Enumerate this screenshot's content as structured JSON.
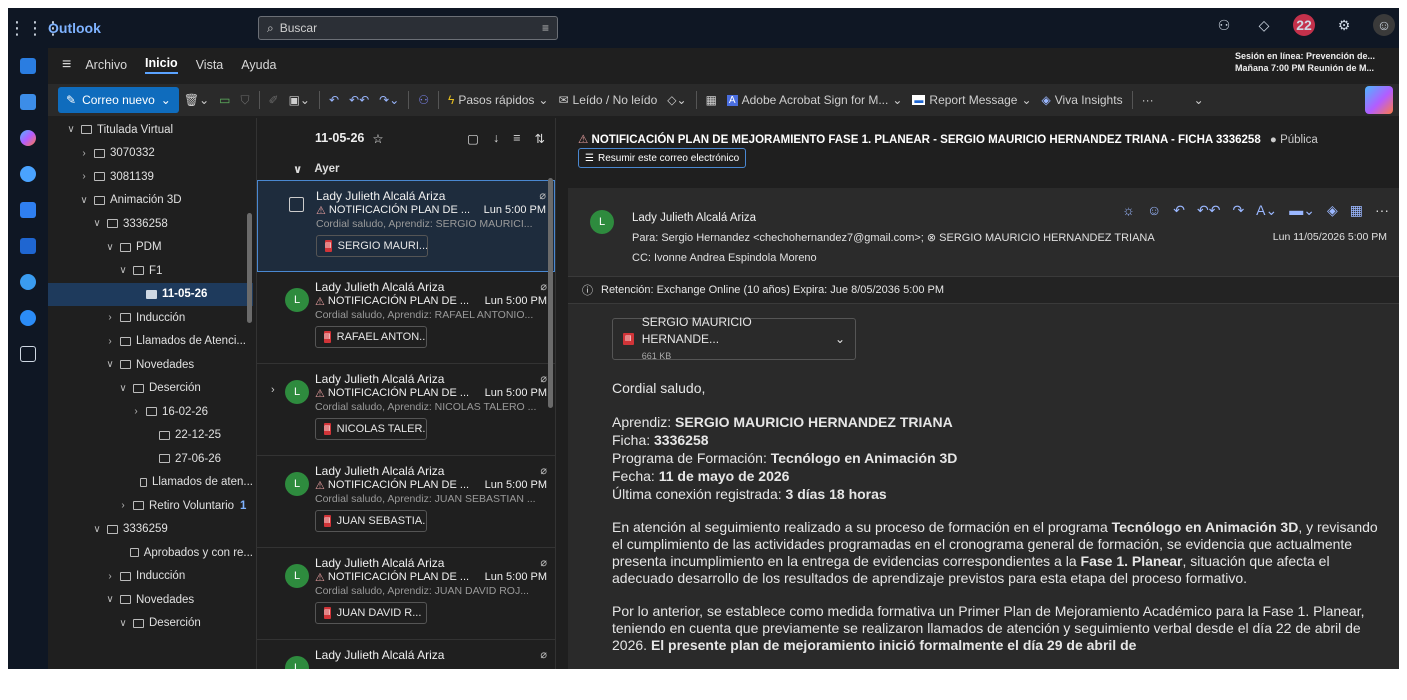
{
  "app": {
    "name": "Outlook"
  },
  "search": {
    "placeholder": "Buscar"
  },
  "topbar": {
    "notif_count": "22"
  },
  "menu": {
    "items": [
      "Archivo",
      "Inicio",
      "Vista",
      "Ayuda"
    ],
    "active": "Inicio"
  },
  "notification": {
    "line1": "Sesión en línea: Prevención de...",
    "line2": "Mañana 7:00 PM Reunión de M..."
  },
  "toolbar": {
    "new_mail": "Correo nuevo",
    "quick_steps": "Pasos rápidos",
    "read_unread": "Leído / No leído",
    "adobe": "Adobe Acrobat Sign for M...",
    "report": "Report Message",
    "viva": "Viva Insights",
    "more": "···"
  },
  "folders": [
    {
      "label": "Titulada Virtual",
      "indent": 0,
      "chev": "∨"
    },
    {
      "label": "3070332",
      "indent": 1,
      "chev": "›"
    },
    {
      "label": "3081139",
      "indent": 1,
      "chev": "›"
    },
    {
      "label": "Animación 3D",
      "indent": 1,
      "chev": "∨"
    },
    {
      "label": "3336258",
      "indent": 2,
      "chev": "∨"
    },
    {
      "label": "PDM",
      "indent": 3,
      "chev": "∨"
    },
    {
      "label": "F1",
      "indent": 4,
      "chev": "∨"
    },
    {
      "label": "11-05-26",
      "indent": 5,
      "chev": "",
      "selected": true
    },
    {
      "label": "Inducción",
      "indent": 3,
      "chev": "›"
    },
    {
      "label": "Llamados de Atenci...",
      "indent": 3,
      "chev": "›"
    },
    {
      "label": "Novedades",
      "indent": 3,
      "chev": "∨"
    },
    {
      "label": "Deserción",
      "indent": 4,
      "chev": "∨"
    },
    {
      "label": "16-02-26",
      "indent": 5,
      "chev": "›"
    },
    {
      "label": "22-12-25",
      "indent": 6,
      "chev": ""
    },
    {
      "label": "27-06-26",
      "indent": 6,
      "chev": ""
    },
    {
      "label": "Llamados de aten...",
      "indent": 5,
      "chev": ""
    },
    {
      "label": "Retiro Voluntario",
      "indent": 4,
      "chev": "›",
      "count": "1"
    },
    {
      "label": "3336259",
      "indent": 2,
      "chev": "∨"
    },
    {
      "label": "Aprobados y con re...",
      "indent": 4,
      "chev": ""
    },
    {
      "label": "Inducción",
      "indent": 3,
      "chev": "›"
    },
    {
      "label": "Novedades",
      "indent": 3,
      "chev": "∨"
    },
    {
      "label": "Deserción",
      "indent": 4,
      "chev": "∨"
    }
  ],
  "list": {
    "folder_title": "11-05-26",
    "group": "Ayer",
    "messages": [
      {
        "sender": "Lady Julieth Alcalá Ariza",
        "subject": "NOTIFICACIÓN PLAN DE ...",
        "time": "Lun 5:00 PM",
        "preview": "Cordial saludo, Aprendiz: SERGIO MAURICI...",
        "attachment": "SERGIO MAURI...",
        "selected": true
      },
      {
        "sender": "Lady Julieth Alcalá Ariza",
        "subject": "NOTIFICACIÓN PLAN DE ...",
        "time": "Lun 5:00 PM",
        "preview": "Cordial saludo, Aprendiz: RAFAEL ANTONIO...",
        "attachment": "RAFAEL ANTON..."
      },
      {
        "sender": "Lady Julieth Alcalá Ariza",
        "subject": "NOTIFICACIÓN PLAN DE ...",
        "time": "Lun 5:00 PM",
        "preview": "Cordial saludo, Aprendiz: NICOLAS TALERO ...",
        "attachment": "NICOLAS TALER...",
        "expand": true
      },
      {
        "sender": "Lady Julieth Alcalá Ariza",
        "subject": "NOTIFICACIÓN PLAN DE ...",
        "time": "Lun 5:00 PM",
        "preview": "Cordial saludo, Aprendiz: JUAN SEBASTIAN ...",
        "attachment": "JUAN SEBASTIA..."
      },
      {
        "sender": "Lady Julieth Alcalá Ariza",
        "subject": "NOTIFICACIÓN PLAN DE ...",
        "time": "Lun 5:00 PM",
        "preview": "Cordial saludo, Aprendiz: JUAN DAVID ROJ...",
        "attachment": "JUAN DAVID R..."
      },
      {
        "sender": "Lady Julieth Alcalá Ariza",
        "subject": "",
        "time": "",
        "preview": "",
        "attachment": ""
      }
    ]
  },
  "reading": {
    "subject": "NOTIFICACIÓN PLAN DE MEJORAMIENTO FASE 1. PLANEAR  - SERGIO MAURICIO HERNANDEZ TRIANA - FICHA 3336258",
    "visibility": "Pública",
    "summarize": "Resumir este correo electrónico",
    "from": "Lady Julieth Alcalá Ariza",
    "avatar": "L",
    "to": "Para:  Sergio Hernandez <chechohernandez7@gmail.com>;  ⊗ SERGIO MAURICIO HERNANDEZ TRIANA",
    "cc": "CC:  Ivonne Andrea Espindola Moreno",
    "date": "Lun 11/05/2026 5:00 PM",
    "retention": "Retención: Exchange Online (10 años) Expira: Jue 8/05/2036 5:00 PM",
    "attachment_name": "SERGIO MAURICIO HERNANDE...",
    "attachment_size": "661 KB",
    "greeting": "Cordial saludo,",
    "aprendiz_label": "Aprendiz: ",
    "aprendiz": "SERGIO MAURICIO HERNANDEZ TRIANA",
    "ficha_label": "Ficha: ",
    "ficha": "3336258",
    "programa_label": "Programa de Formación: ",
    "programa": "Tecnólogo en Animación 3D",
    "fecha_label": "Fecha: ",
    "fecha": "11 de mayo de 2026",
    "conexion_label": "Última conexión registrada: ",
    "conexion": "3 días 18 horas",
    "p1a": "En atención al seguimiento realizado a su proceso de formación en el programa ",
    "p1b": "Tecnólogo en Animación 3D",
    "p1c": ", y revisando el cumplimiento de las actividades programadas en el cronograma general de formación, se evidencia que actualmente presenta incumplimiento en la entrega de evidencias correspondientes a la ",
    "p1d": "Fase 1. Planear",
    "p1e": ", situación que afecta el adecuado desarrollo de los resultados de aprendizaje previstos para esta etapa del proceso formativo.",
    "p2a": "Por lo anterior, se establece como medida formativa un Primer Plan de Mejoramiento Académico para la Fase 1. Planear, teniendo en cuenta que previamente se realizaron llamados de atención y seguimiento verbal desde el día 22 de abril de 2026. ",
    "p2b": "El presente plan de mejoramiento inició formalmente el día 29 de abril de"
  }
}
